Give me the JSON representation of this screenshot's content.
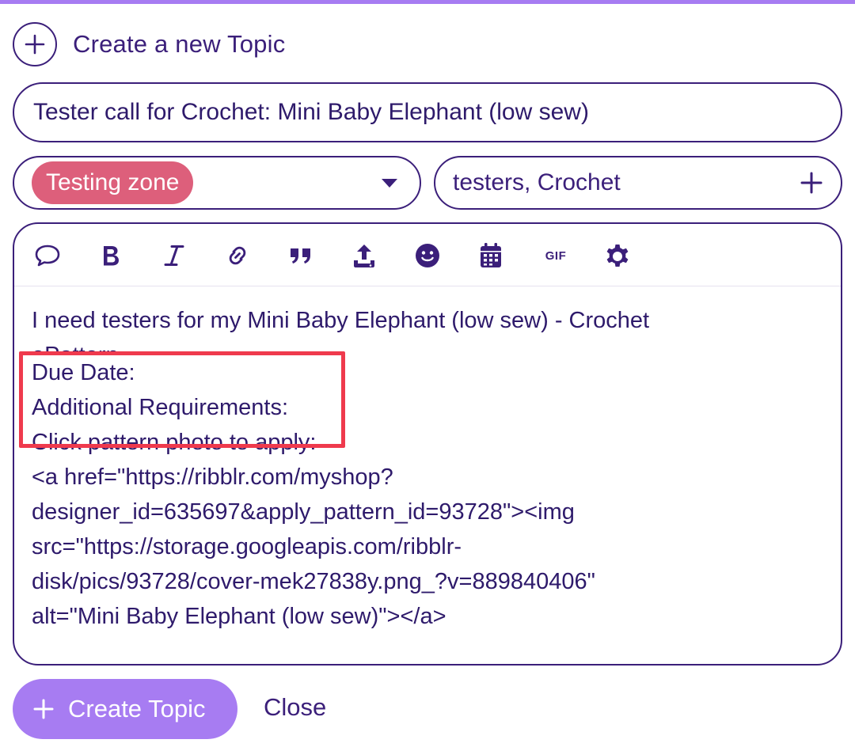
{
  "header": {
    "title": "Create a new Topic"
  },
  "form": {
    "title_value": "Tester call for Crochet: Mini Baby Elephant (low sew)",
    "category_selected": "Testing zone",
    "tags_value": "testers, Crochet"
  },
  "toolbar": {
    "items": [
      {
        "icon": "speech-bubble-icon"
      },
      {
        "icon": "bold-icon",
        "label": "B"
      },
      {
        "icon": "italic-icon",
        "label": "I"
      },
      {
        "icon": "link-icon"
      },
      {
        "icon": "quote-icon"
      },
      {
        "icon": "upload-icon"
      },
      {
        "icon": "emoji-icon"
      },
      {
        "icon": "calendar-icon"
      },
      {
        "icon": "gif-icon",
        "label": "GIF"
      },
      {
        "icon": "gear-icon"
      }
    ]
  },
  "editor": {
    "lines": [
      "I need testers for my Mini Baby Elephant (low sew) - Crochet",
      "ePattern",
      "Due Date:",
      "Additional Requirements:",
      "Click pattern photo to apply:",
      "<a href=\"https://ribblr.com/myshop?",
      "designer_id=635697&apply_pattern_id=93728\"><img",
      "src=\"https://storage.googleapis.com/ribblr-",
      "disk/pics/93728/cover-mek27838y.png_?v=889840406\"",
      "alt=\"Mini Baby Elephant (low sew)\"></a>"
    ]
  },
  "actions": {
    "create_label": "Create Topic",
    "close_label": "Close"
  },
  "colors": {
    "accent": "#a77cf2",
    "text": "#3b1f7a",
    "category_badge": "#dd5f7b",
    "highlight": "#ef3a4d"
  }
}
